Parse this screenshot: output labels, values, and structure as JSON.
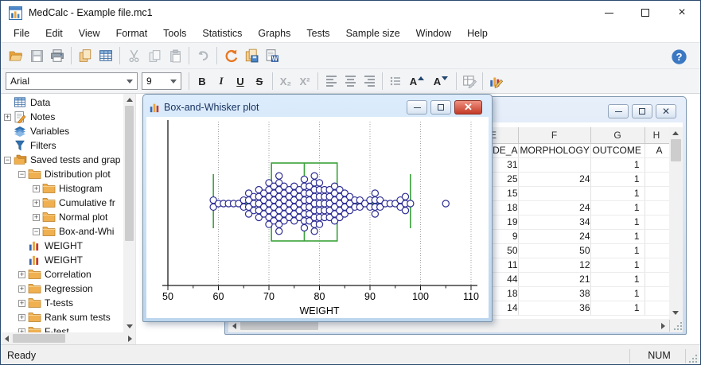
{
  "window": {
    "title": "MedCalc - Example file.mc1"
  },
  "menu": {
    "items": [
      "File",
      "Edit",
      "View",
      "Format",
      "Tools",
      "Statistics",
      "Graphs",
      "Tests",
      "Sample size",
      "Window",
      "Help"
    ]
  },
  "toolbar": {
    "icons": [
      "open-folder",
      "save",
      "print",
      "copy-page",
      "data-grid",
      "cut",
      "copy",
      "paste",
      "undo",
      "refresh",
      "save-pages",
      "export-word",
      "help"
    ]
  },
  "format_bar": {
    "font": "Arial",
    "font_size": "9",
    "bold": "B",
    "italic": "I",
    "underline": "U",
    "strike": "S",
    "subscript": "X₂",
    "superscript": "X²",
    "font_up": "A",
    "font_down": "A"
  },
  "sidebar": {
    "items": [
      {
        "label": "Data",
        "icon": "data-table",
        "level": 0,
        "expand": null
      },
      {
        "label": "Notes",
        "icon": "notes",
        "level": 0,
        "expand": "plus"
      },
      {
        "label": "Variables",
        "icon": "variables",
        "level": 0,
        "expand": null
      },
      {
        "label": "Filters",
        "icon": "filter",
        "level": 0,
        "expand": null
      },
      {
        "label": "Saved tests and grap",
        "icon": "folders",
        "level": 0,
        "expand": "minus"
      },
      {
        "label": "Distribution plot",
        "icon": "folder",
        "level": 1,
        "expand": "minus"
      },
      {
        "label": "Histogram",
        "icon": "folder",
        "level": 2,
        "expand": "plus"
      },
      {
        "label": "Cumulative fr",
        "icon": "folder",
        "level": 2,
        "expand": "plus"
      },
      {
        "label": "Normal plot",
        "icon": "folder",
        "level": 2,
        "expand": "plus"
      },
      {
        "label": "Box-and-Whi",
        "icon": "folder",
        "level": 2,
        "expand": "minus"
      },
      {
        "label": "WEIGHT",
        "icon": "chart",
        "level": 1,
        "expand": null
      },
      {
        "label": "WEIGHT",
        "icon": "chart",
        "level": 1,
        "expand": null
      },
      {
        "label": "Correlation",
        "icon": "folder",
        "level": 1,
        "expand": "plus"
      },
      {
        "label": "Regression",
        "icon": "folder",
        "level": 1,
        "expand": "plus"
      },
      {
        "label": "T-tests",
        "icon": "folder",
        "level": 1,
        "expand": "plus"
      },
      {
        "label": "Rank sum tests",
        "icon": "folder",
        "level": 1,
        "expand": "plus"
      },
      {
        "label": "F-test",
        "icon": "folder",
        "level": 1,
        "expand": "plus"
      }
    ]
  },
  "plot_window": {
    "title": "Box-and-Whisker plot"
  },
  "chart_data": {
    "type": "box",
    "orientation": "horizontal",
    "title": "",
    "xlabel": "WEIGHT",
    "xlim": [
      50,
      110
    ],
    "xticks": [
      50,
      60,
      70,
      80,
      90,
      100,
      110
    ],
    "xticks_minor": [
      55,
      65,
      75,
      85,
      95,
      105
    ],
    "grid": "vertical-dotted",
    "box": {
      "whisker_low": 59,
      "q1": 70.5,
      "median": 77,
      "q3": 83.5,
      "whisker_high": 98
    },
    "outliers": [
      105
    ],
    "points": [
      [
        59,
        2
      ],
      [
        60,
        1
      ],
      [
        61,
        1
      ],
      [
        62,
        1
      ],
      [
        63,
        1
      ],
      [
        64,
        1
      ],
      [
        65,
        2
      ],
      [
        66,
        4
      ],
      [
        67,
        3
      ],
      [
        68,
        5
      ],
      [
        69,
        4
      ],
      [
        70,
        7
      ],
      [
        71,
        6
      ],
      [
        72,
        9
      ],
      [
        73,
        6
      ],
      [
        74,
        5
      ],
      [
        75,
        6
      ],
      [
        76,
        5
      ],
      [
        77,
        8
      ],
      [
        78,
        6
      ],
      [
        79,
        9
      ],
      [
        80,
        7
      ],
      [
        81,
        5
      ],
      [
        82,
        5
      ],
      [
        83,
        6
      ],
      [
        84,
        5
      ],
      [
        85,
        4
      ],
      [
        86,
        3
      ],
      [
        87,
        2
      ],
      [
        88,
        2
      ],
      [
        89,
        1
      ],
      [
        90,
        2
      ],
      [
        91,
        4
      ],
      [
        92,
        2
      ],
      [
        93,
        1
      ],
      [
        94,
        1
      ],
      [
        95,
        1
      ],
      [
        96,
        2
      ],
      [
        97,
        3
      ],
      [
        98,
        1
      ]
    ]
  },
  "spreadsheet": {
    "column_letters": [
      "E",
      "F",
      "G",
      "H"
    ],
    "field_row": [
      "DE_A",
      "MORPHOLOGY",
      "OUTCOME",
      "A"
    ],
    "rows": [
      [
        "31",
        "",
        "1",
        ""
      ],
      [
        "25",
        "24",
        "1",
        ""
      ],
      [
        "15",
        "",
        "1",
        ""
      ],
      [
        "18",
        "24",
        "1",
        ""
      ],
      [
        "19",
        "34",
        "1",
        ""
      ],
      [
        "9",
        "24",
        "1",
        ""
      ],
      [
        "50",
        "50",
        "1",
        ""
      ],
      [
        "11",
        "12",
        "1",
        ""
      ],
      [
        "44",
        "21",
        "1",
        ""
      ],
      [
        "18",
        "38",
        "1",
        ""
      ],
      [
        "14",
        "36",
        "1",
        ""
      ]
    ]
  },
  "status_bar": {
    "left": "Ready",
    "num": "NUM"
  },
  "colors": {
    "box_green": "#3aa13a",
    "dot_blue": "#2d2d94",
    "aero_title_text": "#15315e",
    "close_red": "#c33b27",
    "folder_orange": "#f0b050",
    "grid_dotted": "#a0a0a0"
  }
}
